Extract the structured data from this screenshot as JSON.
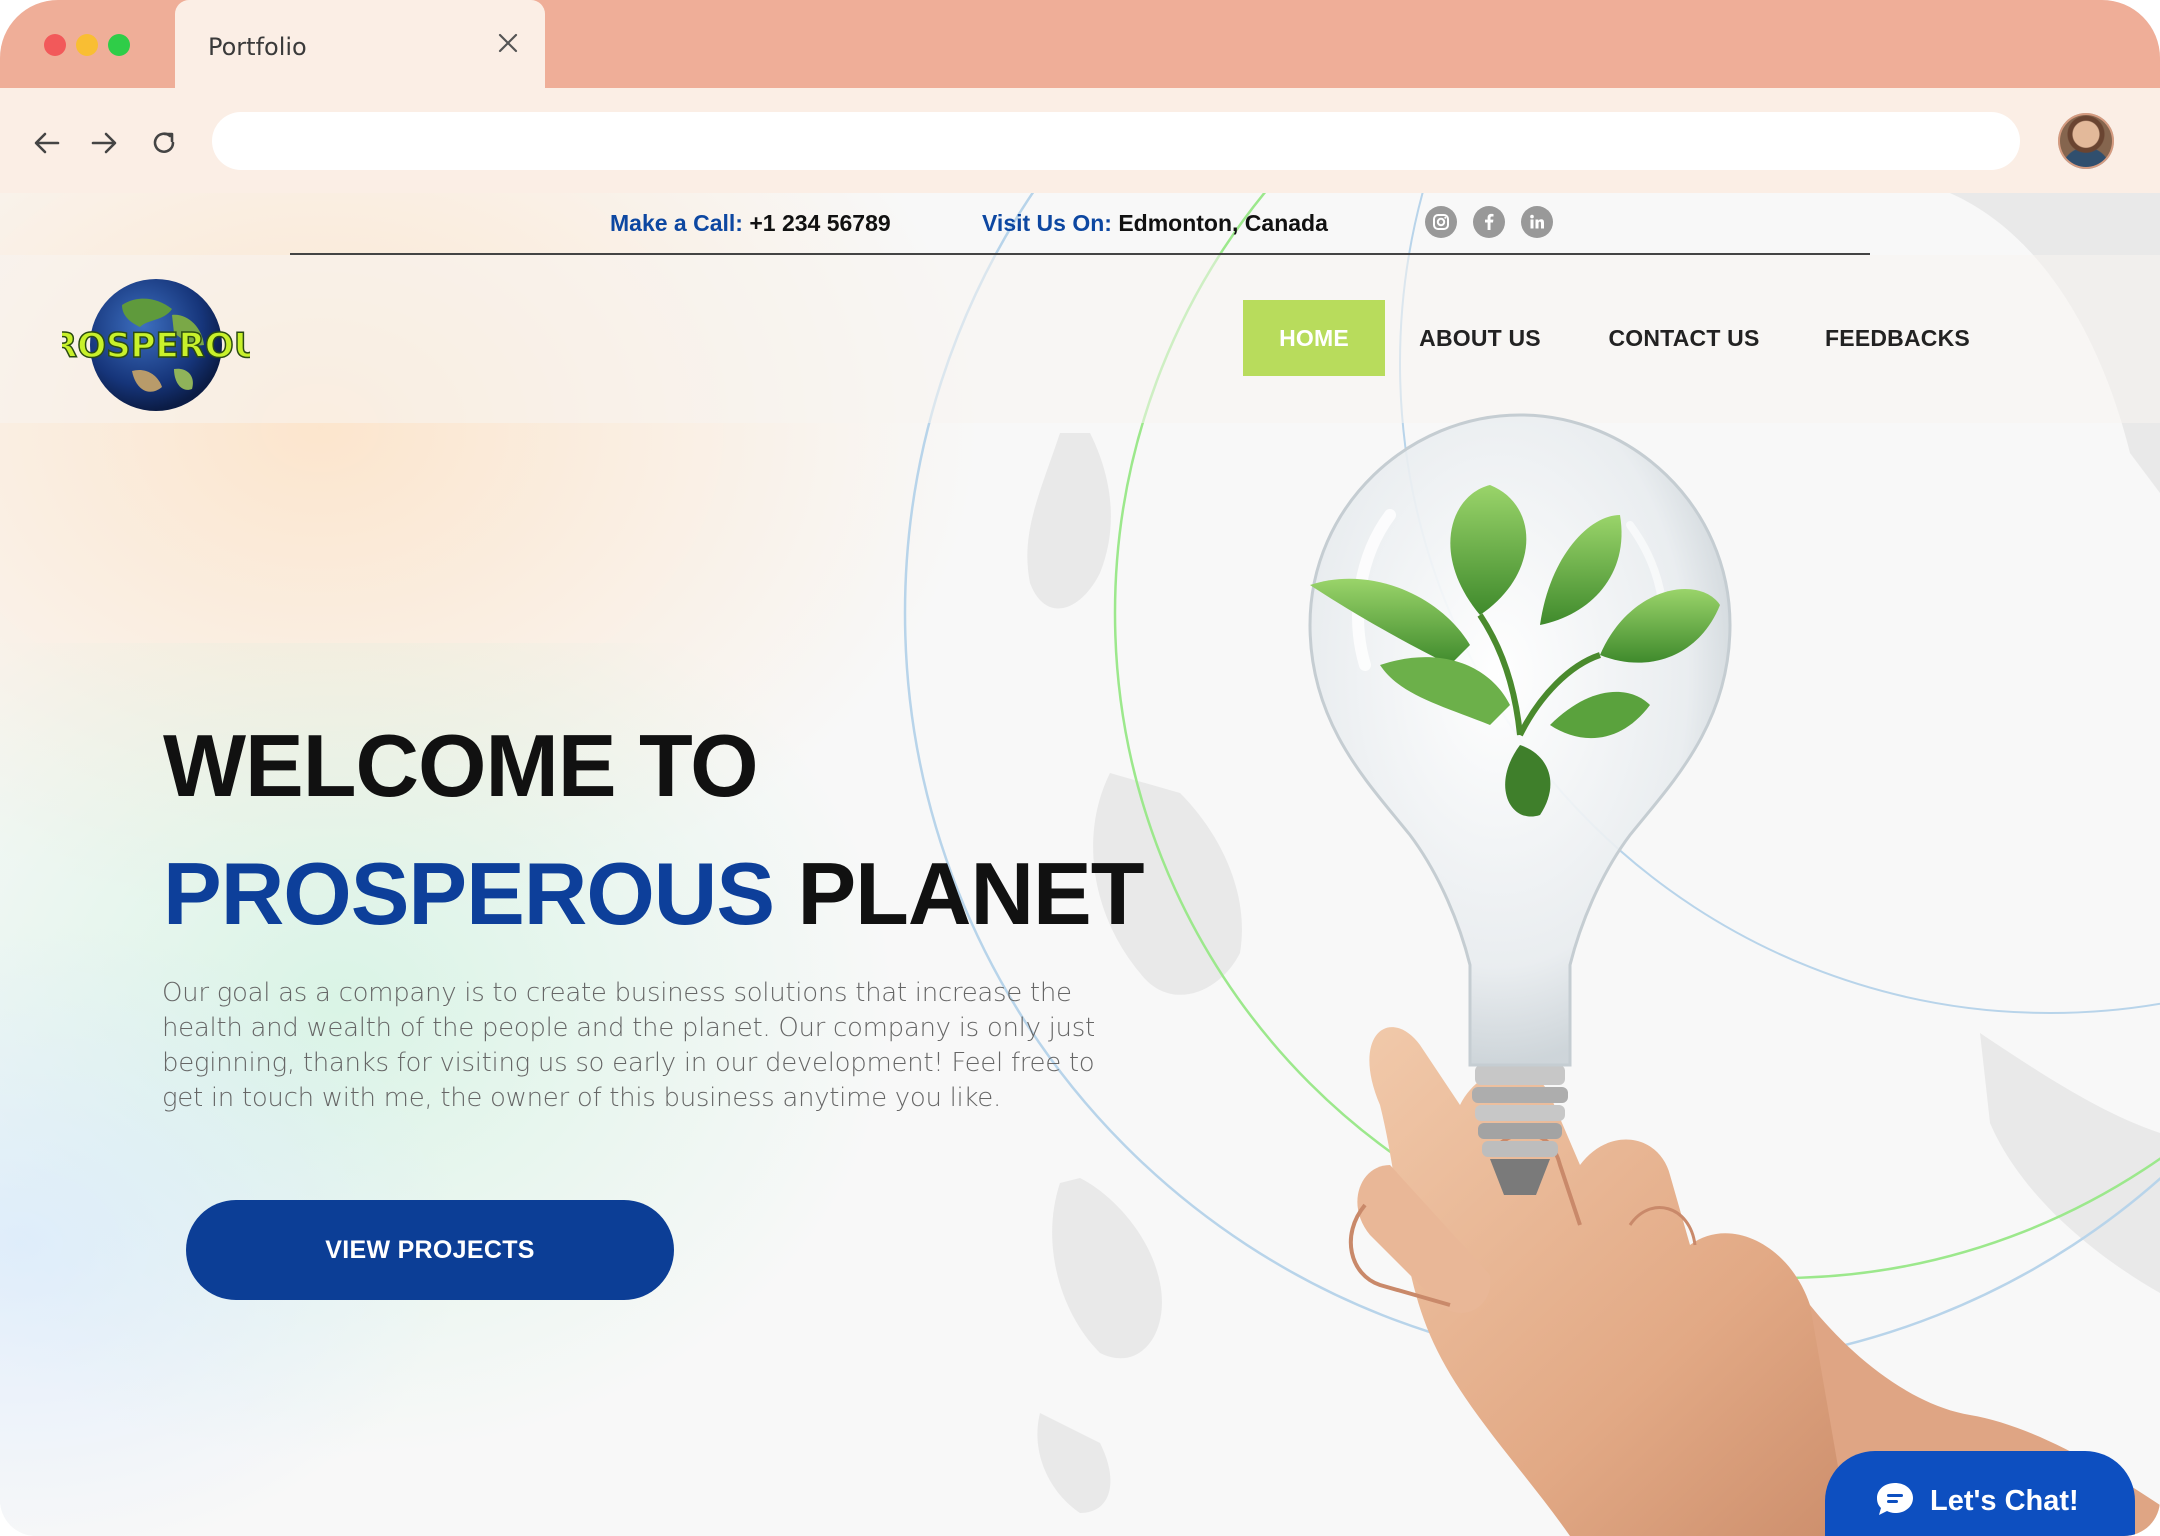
{
  "browser": {
    "tab_title": "Portfolio",
    "address_value": ""
  },
  "topbar": {
    "call_label": "Make a Call:",
    "call_value": "+1 234 56789",
    "visit_label": "Visit Us On:",
    "visit_value": "Edmonton, Canada",
    "social_icons": [
      "instagram-icon",
      "facebook-icon",
      "linkedin-icon"
    ]
  },
  "logo": {
    "text": "PROSPEROUS"
  },
  "nav": {
    "items": [
      {
        "label": "HOME"
      },
      {
        "label": "ABOUT US"
      },
      {
        "label": "CONTACT US"
      },
      {
        "label": "FEEDBACKS"
      }
    ],
    "active": "HOME"
  },
  "hero": {
    "line1": "WELCOME TO",
    "line2_highlight": "PROSPEROUS",
    "line2_rest": "PLANET",
    "description": "Our goal as a company is to create business solutions that increase the health and wealth of the people and the planet. Our company is only just beginning, thanks for visiting us so early in our development! Feel free to get in touch with me, the owner of this business anytime you like.",
    "cta_label": "VIEW PROJECTS"
  },
  "chat": {
    "label": "Let's Chat!"
  },
  "colors": {
    "tabbar": "#efae98",
    "chrome": "#fbeee5",
    "brand_blue": "#0d3f9a",
    "nav_active": "#b8dc5c",
    "chat_blue": "#0d4fc0"
  }
}
